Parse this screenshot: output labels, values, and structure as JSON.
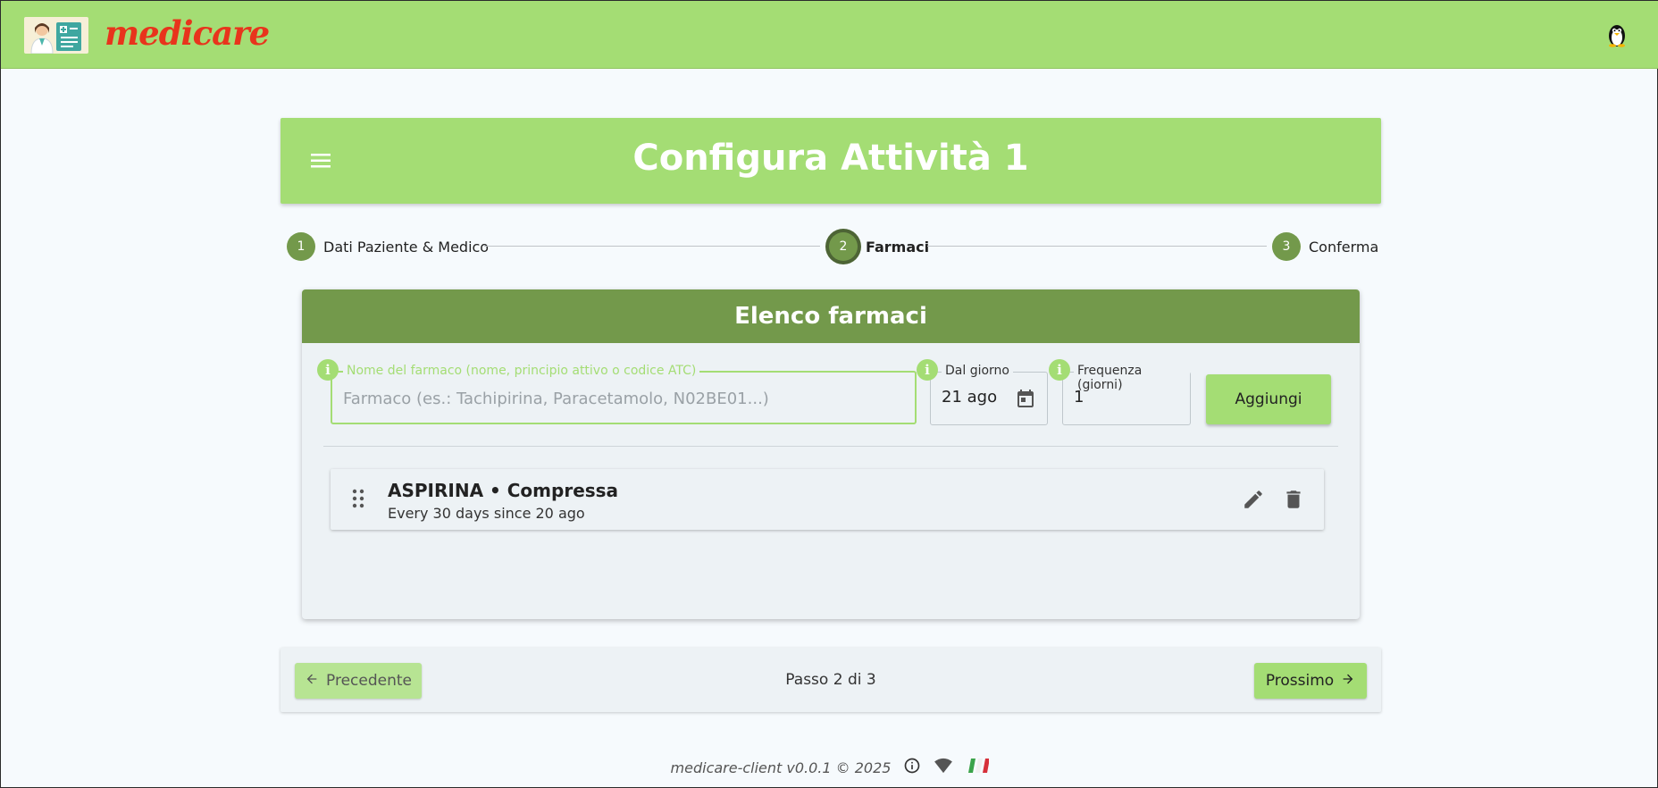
{
  "app": {
    "brand": "medicare",
    "logo_icon": "doctor-clipboard-icon",
    "user_icon": "penguin-icon"
  },
  "header": {
    "title": "Configura Attività 1",
    "menu_icon": "menu-icon"
  },
  "stepper": {
    "steps": [
      {
        "number": "1",
        "label": "Dati Paziente & Medico",
        "active": false
      },
      {
        "number": "2",
        "label": "Farmaci",
        "active": true
      },
      {
        "number": "3",
        "label": "Conferma",
        "active": false
      }
    ]
  },
  "list": {
    "title": "Elenco farmaci",
    "drug_field": {
      "label": "Nome del farmaco (nome, principio attivo o codice ATC)",
      "placeholder": "Farmaco (es.: Tachipirina, Paracetamolo, N02BE01...)",
      "value": ""
    },
    "date_field": {
      "label": "Dal giorno",
      "value": "21 ago"
    },
    "frequency_field": {
      "label": "Frequenza (giorni)",
      "value": "1"
    },
    "add_button": "Aggiungi",
    "items": [
      {
        "title": "ASPIRINA • Compressa",
        "subtitle": "Every 30 days since 20 ago"
      }
    ]
  },
  "navigation": {
    "prev_label": "Precedente",
    "next_label": "Prossimo",
    "counter": "Passo 2 di 3"
  },
  "footer": {
    "text": "medicare-client v0.0.1 © 2025"
  },
  "colors": {
    "accent": "#a4dd74",
    "accent_dark": "#73994b",
    "brand_red": "#e8341c",
    "background": "#f6fafd"
  }
}
